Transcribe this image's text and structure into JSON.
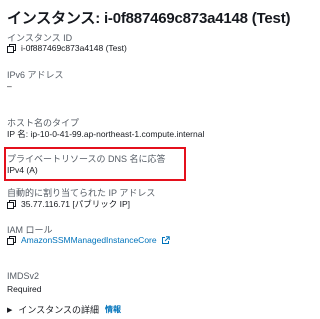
{
  "page": {
    "title": "インスタンス: i-0f887469c873a4148 (Test)"
  },
  "fields": {
    "instance_id": {
      "label": "インスタンス ID",
      "value": "i-0f887469c873a4148 (Test)"
    },
    "ipv6": {
      "label": "IPv6 アドレス",
      "value": "–"
    },
    "hostname_type": {
      "label": "ホスト名のタイプ",
      "value": "IP 名: ip-10-0-41-99.ap-northeast-1.compute.internal"
    },
    "private_dns": {
      "label": "プライベートリソースの DNS 名に応答",
      "value": "IPv4 (A)"
    },
    "auto_ip": {
      "label": "自動的に割り当てられた IP アドレス",
      "value": "35.77.116.71 [パブリック IP]"
    },
    "iam_role": {
      "label": "IAM ロール",
      "value": "AmazonSSMManagedInstanceCore"
    },
    "imdsv2": {
      "label": "IMDSv2",
      "value": "Required"
    }
  },
  "details": {
    "label": "インスタンスの詳細",
    "info": "情報"
  },
  "icons": {
    "copy": "copy-icon",
    "external": "external-link-icon",
    "caret": "caret-right-icon"
  },
  "colors": {
    "link": "#0073bb",
    "highlight_border": "#e4101c",
    "label": "#545b64",
    "text": "#16191f"
  }
}
